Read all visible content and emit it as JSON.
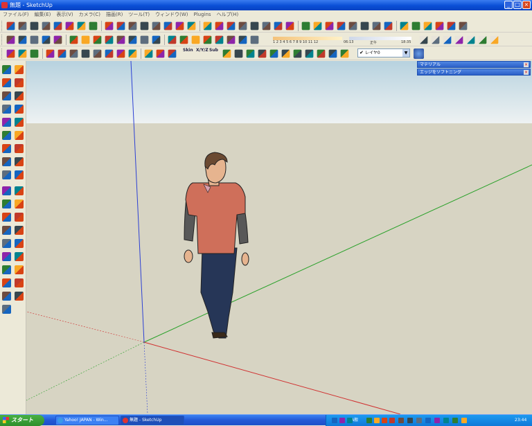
{
  "window": {
    "title": "無題 - SketchUp",
    "controls": [
      "_",
      "□",
      "×"
    ]
  },
  "menu": [
    "ファイル(F)",
    "編集(E)",
    "表示(V)",
    "カメラ(C)",
    "描画(R)",
    "ツール(T)",
    "ウィンドウ(W)",
    "Plugins",
    "ヘルプ(H)"
  ],
  "shadows": {
    "months": "1 2 3 4 5 6 7 8 9 10 11 12",
    "time_start": "06:13",
    "noon": "正午",
    "time_end": "18:35"
  },
  "toolbar3": {
    "scene_labels": [
      "Skin",
      "X/Y/Z",
      "Sub"
    ]
  },
  "layer": {
    "current": "レイヤ0"
  },
  "panels": [
    {
      "title": "マテリアル"
    },
    {
      "title": "エッジをソフトニング"
    }
  ],
  "taskbar": {
    "start_label": "スタート",
    "tasks": [
      {
        "label": "Yahoo! JAPAN - Win..."
      },
      {
        "label": "無題 - SketchUp"
      }
    ],
    "tray_ime": "A般",
    "tray_time": "23:44"
  },
  "colors": {
    "sky_top": "#b7d2df",
    "sky_bottom": "#eef2f2",
    "ground": "#d7d4c3",
    "axis_red": "#d03030",
    "axis_green": "#2aa12a",
    "axis_blue": "#2b3fd4",
    "shirt": "#cf6f5a",
    "pants": "#263657",
    "sleeves": "#585858"
  },
  "icons": {
    "toolbar": [
      "select-icon",
      "pencil-icon",
      "rectangle-icon",
      "circle-icon",
      "arc-icon",
      "eraser-icon",
      "paint-bucket-icon",
      "tape-measure-icon",
      "push-pull-icon",
      "move-icon",
      "rotate-icon",
      "orbit-icon",
      "pan-icon",
      "zoom-icon",
      "zoom-extents-icon"
    ],
    "left": [
      "select-icon",
      "component-icon",
      "paint-icon",
      "eraser-icon",
      "rectangle-icon",
      "line-icon",
      "circle-icon",
      "arc-icon",
      "polygon-icon",
      "freehand-icon",
      "move-icon",
      "push-pull-icon",
      "rotate-icon",
      "follow-me-icon",
      "scale-icon",
      "offset-icon",
      "tape-icon",
      "dimension-icon",
      "protractor-icon",
      "text-icon",
      "axes-icon",
      "3d-text-icon",
      "orbit-icon",
      "pan-icon",
      "zoom-icon",
      "zoom-window-icon",
      "previous-icon",
      "zoom-extents-icon",
      "position-camera-icon",
      "look-around-icon",
      "walk-icon",
      "section-icon",
      "sandbox-icon"
    ]
  }
}
